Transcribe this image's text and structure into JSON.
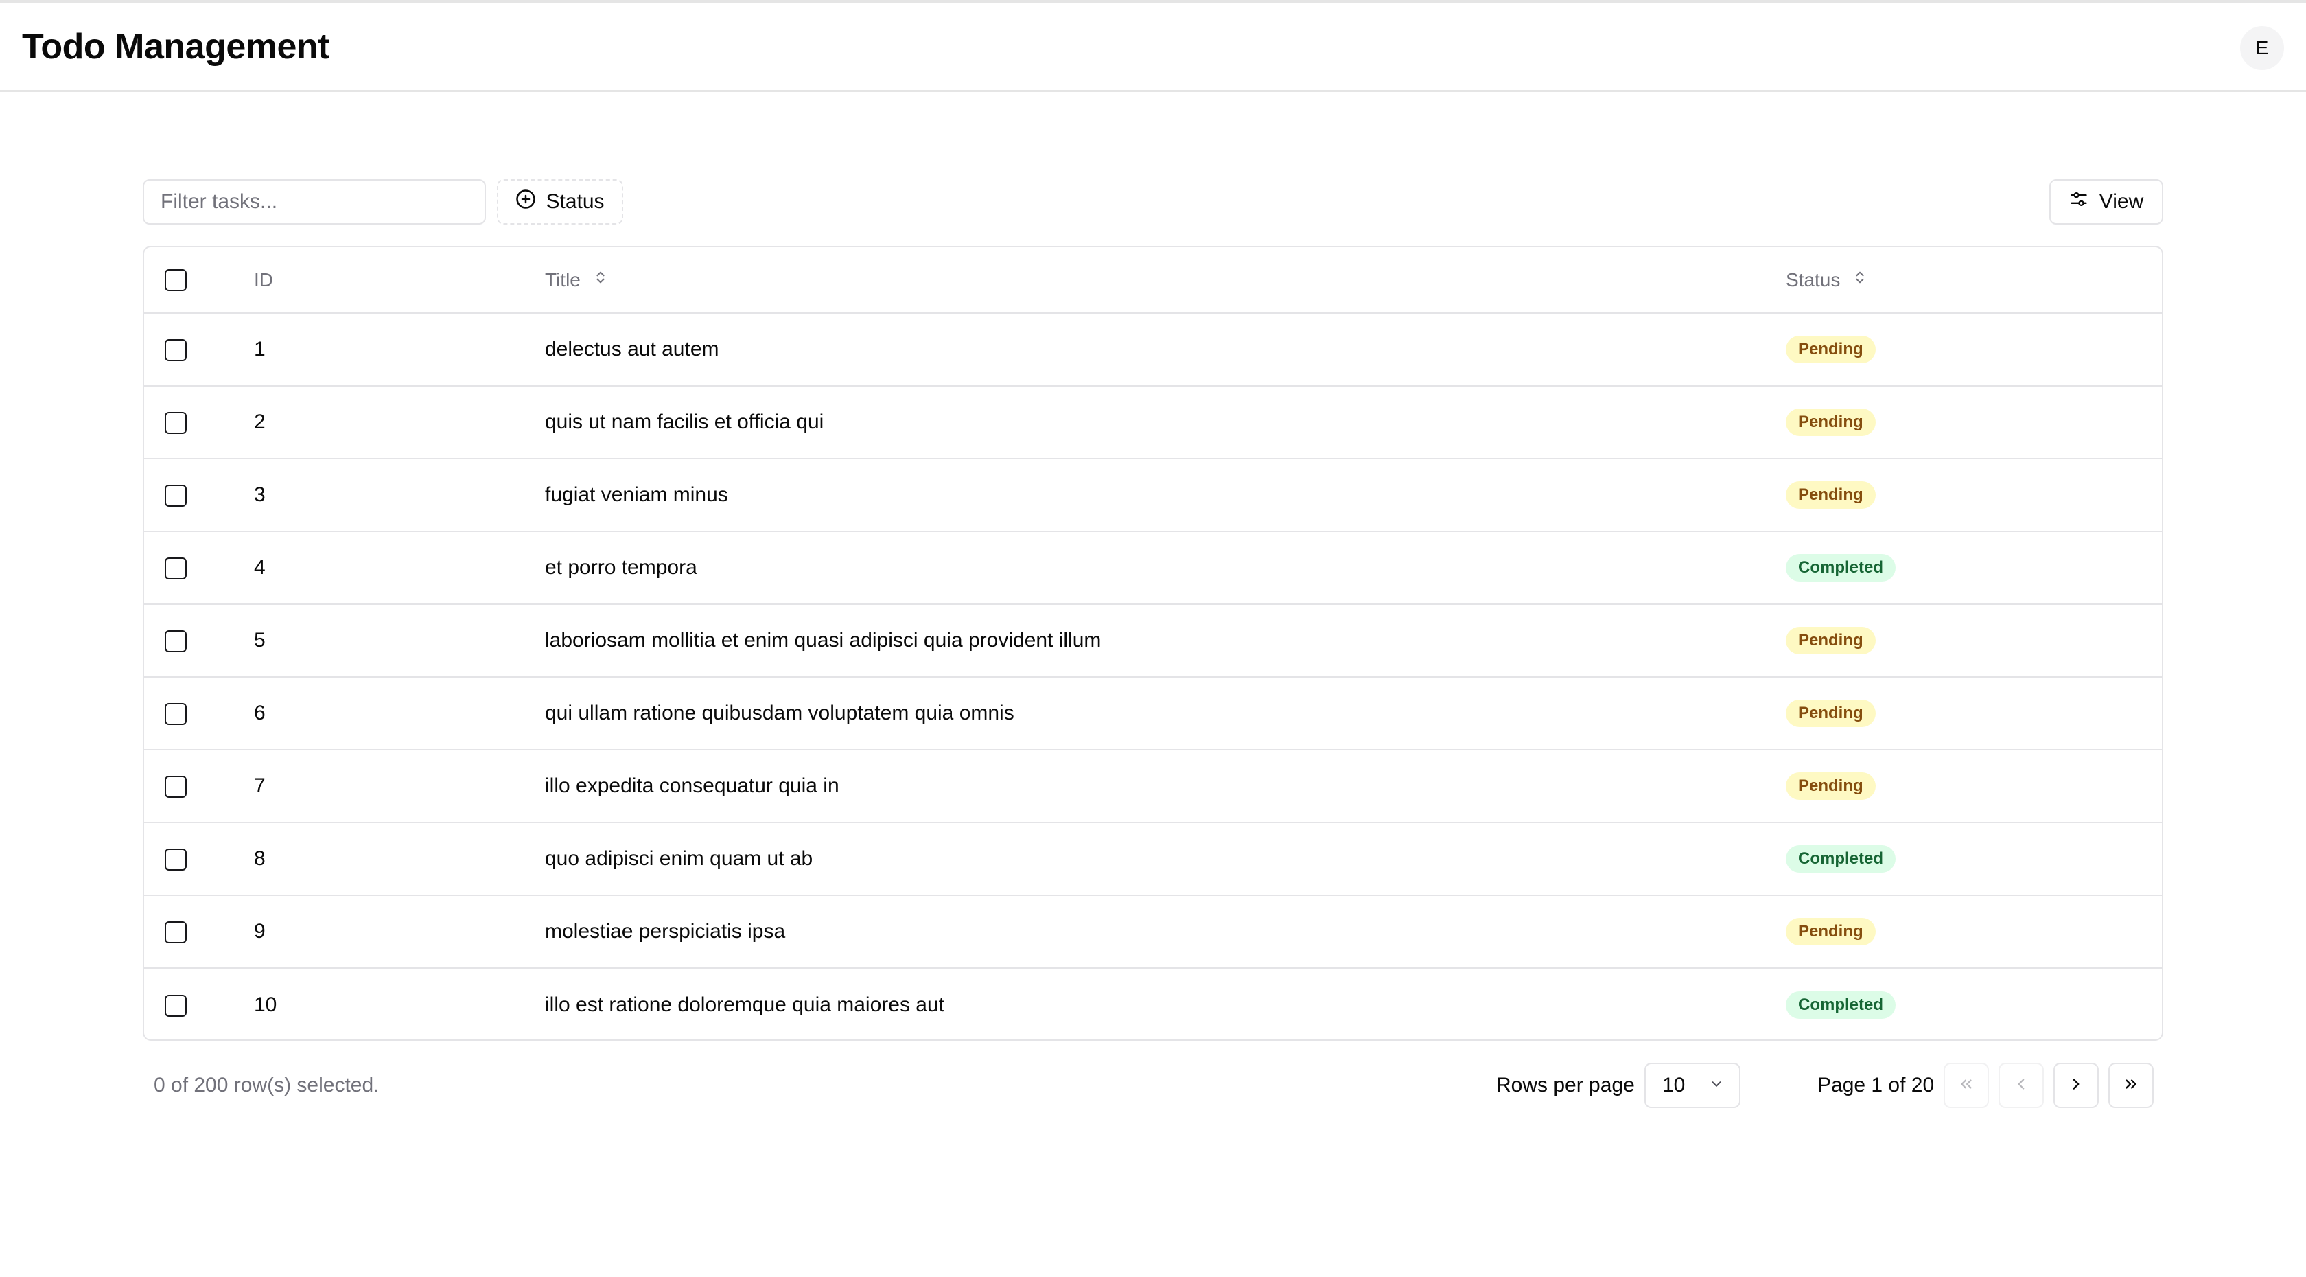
{
  "header": {
    "title": "Todo Management",
    "avatar_initial": "E"
  },
  "toolbar": {
    "filter_placeholder": "Filter tasks...",
    "status_filter_label": "Status",
    "view_label": "View"
  },
  "table": {
    "columns": {
      "id": "ID",
      "title": "Title",
      "status": "Status"
    },
    "rows": [
      {
        "id": "1",
        "title": "delectus aut autem",
        "status": "Pending"
      },
      {
        "id": "2",
        "title": "quis ut nam facilis et officia qui",
        "status": "Pending"
      },
      {
        "id": "3",
        "title": "fugiat veniam minus",
        "status": "Pending"
      },
      {
        "id": "4",
        "title": "et porro tempora",
        "status": "Completed"
      },
      {
        "id": "5",
        "title": "laboriosam mollitia et enim quasi adipisci quia provident illum",
        "status": "Pending"
      },
      {
        "id": "6",
        "title": "qui ullam ratione quibusdam voluptatem quia omnis",
        "status": "Pending"
      },
      {
        "id": "7",
        "title": "illo expedita consequatur quia in",
        "status": "Pending"
      },
      {
        "id": "8",
        "title": "quo adipisci enim quam ut ab",
        "status": "Completed"
      },
      {
        "id": "9",
        "title": "molestiae perspiciatis ipsa",
        "status": "Pending"
      },
      {
        "id": "10",
        "title": "illo est ratione doloremque quia maiores aut",
        "status": "Completed"
      }
    ]
  },
  "footer": {
    "selection_text": "0 of 200 row(s) selected.",
    "rows_per_page_label": "Rows per page",
    "rows_per_page_value": "10",
    "page_info": "Page 1 of 20"
  },
  "colors": {
    "border": "#e4e4e7",
    "muted_text": "#71717a",
    "pending_bg": "#fef9c3",
    "pending_text": "#854d0e",
    "completed_bg": "#dcfce7",
    "completed_text": "#166534"
  },
  "icons": {
    "status_filter": "plus-circle-icon",
    "view": "sliders-icon",
    "sort": "chevrons-up-down-icon",
    "rpp_dropdown": "chevron-down-icon",
    "first_page": "chevrons-left-icon",
    "prev_page": "chevron-left-icon",
    "next_page": "chevron-right-icon",
    "last_page": "chevrons-right-icon"
  }
}
